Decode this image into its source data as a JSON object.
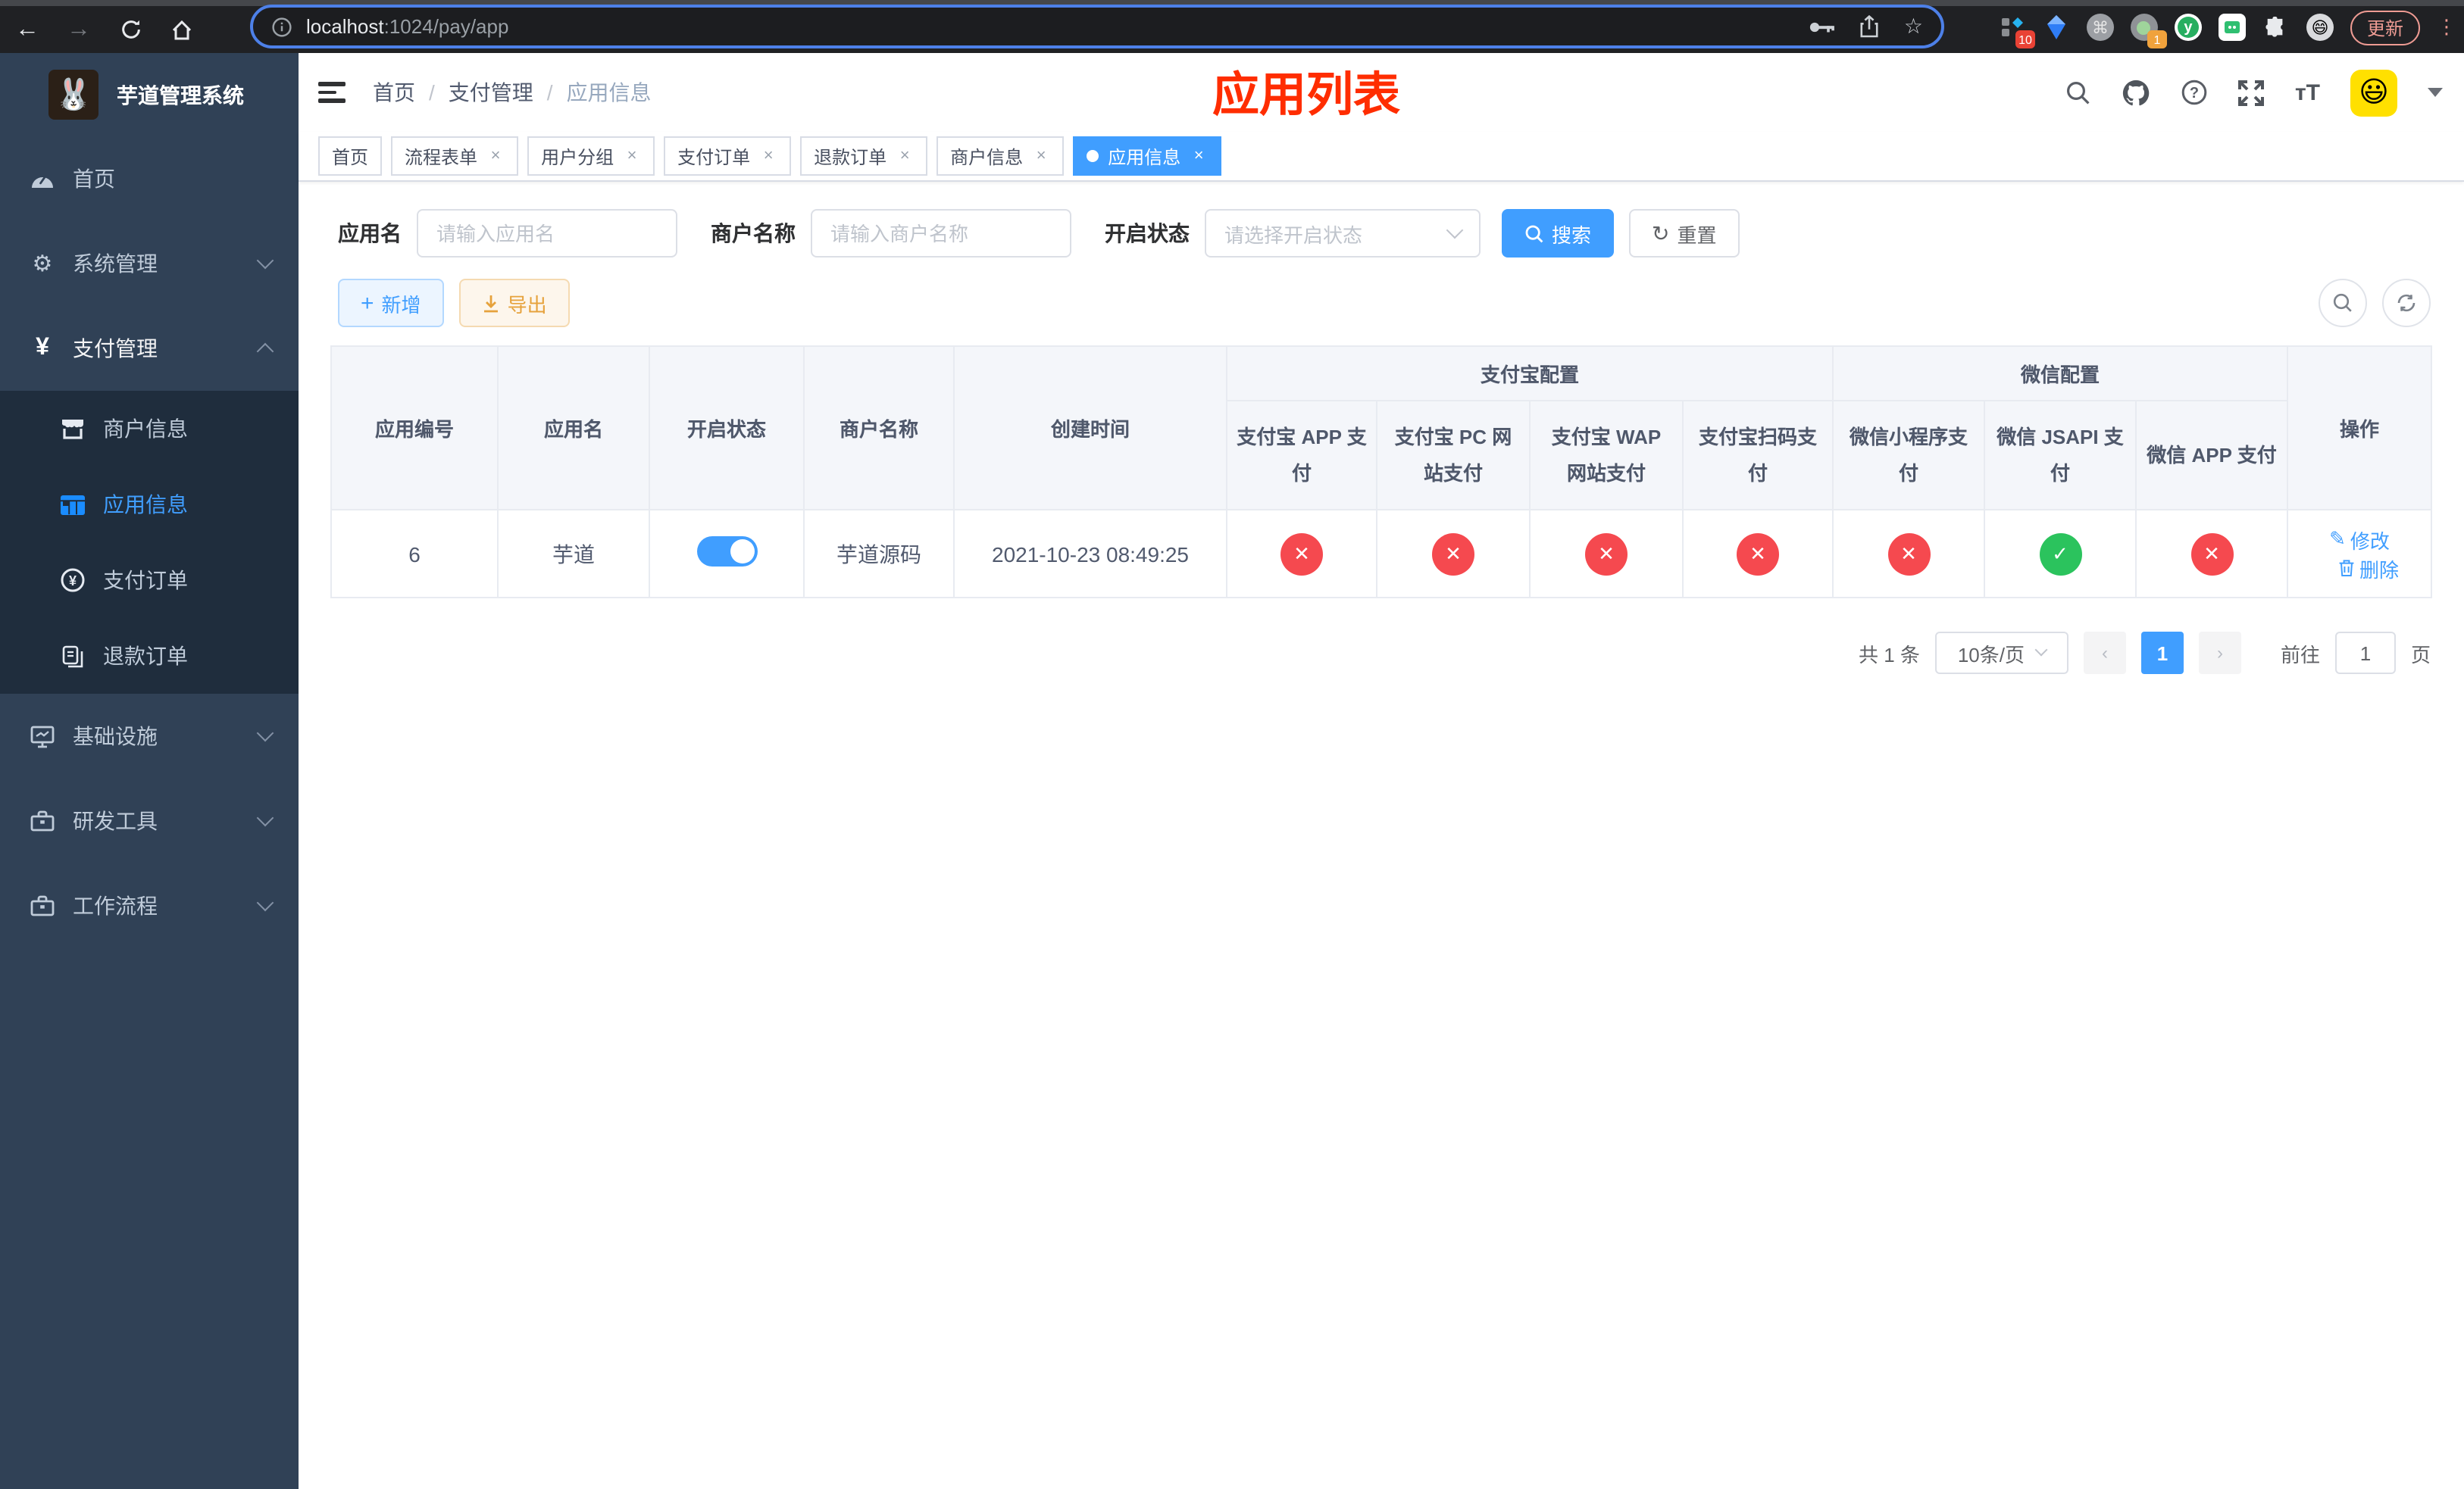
{
  "browser": {
    "url_host": "localhost",
    "url_rest": ":1024/pay/app",
    "ext_badge_blocks": "10",
    "ext_badge_gray": "1",
    "update_label": "更新"
  },
  "sidebar": {
    "logo_title": "芋道管理系统",
    "items": {
      "home": "首页",
      "system": "系统管理",
      "payment": "支付管理",
      "infra": "基础设施",
      "devtools": "研发工具",
      "workflow": "工作流程"
    },
    "submenu": {
      "merchant": "商户信息",
      "app": "应用信息",
      "pay_order": "支付订单",
      "refund_order": "退款订单"
    }
  },
  "navbar": {
    "breadcrumb": [
      "首页",
      "支付管理",
      "应用信息"
    ],
    "annotation_title": "应用列表"
  },
  "tabs": [
    {
      "label": "首页"
    },
    {
      "label": "流程表单"
    },
    {
      "label": "用户分组"
    },
    {
      "label": "支付订单"
    },
    {
      "label": "退款订单"
    },
    {
      "label": "商户信息"
    },
    {
      "label": "应用信息"
    }
  ],
  "filters": {
    "app_name_label": "应用名",
    "app_name_placeholder": "请输入应用名",
    "merchant_label": "商户名称",
    "merchant_placeholder": "请输入商户名称",
    "status_label": "开启状态",
    "status_placeholder": "请选择开启状态",
    "search_label": "搜索",
    "reset_label": "重置"
  },
  "toolbar": {
    "add_label": "新增",
    "export_label": "导出"
  },
  "table": {
    "groups": {
      "alipay": "支付宝配置",
      "wechat": "微信配置"
    },
    "columns": {
      "id": "应用编号",
      "name": "应用名",
      "status": "开启状态",
      "merchant": "商户名称",
      "created": "创建时间",
      "alipay_app": "支付宝 APP 支付",
      "alipay_pc": "支付宝 PC 网站支付",
      "alipay_wap": "支付宝 WAP 网站支付",
      "alipay_qr": "支付宝扫码支付",
      "wx_mini": "微信小程序支付",
      "wx_jsapi": "微信 JSAPI 支付",
      "wx_app": "微信 APP 支付",
      "ops": "操作"
    },
    "row": {
      "id": "6",
      "name": "芋道",
      "enabled": true,
      "merchant": "芋道源码",
      "created_at": "2021-10-23 08:49:25",
      "pay_statuses": [
        false,
        false,
        false,
        false,
        false,
        true,
        false
      ],
      "edit_label": "修改",
      "delete_label": "删除"
    }
  },
  "pagination": {
    "total_text": "共 1 条",
    "page_size": "10条/页",
    "current_page": "1",
    "goto_label": "前往",
    "goto_value": "1",
    "page_unit": "页"
  },
  "colors": {
    "accent": "#409eff",
    "danger": "#f5494f",
    "success": "#2bc35d",
    "warning": "#e6a23c",
    "annotation": "#ff2d00",
    "sidebar_bg": "#304156",
    "submenu_bg": "#1f2d3d"
  }
}
